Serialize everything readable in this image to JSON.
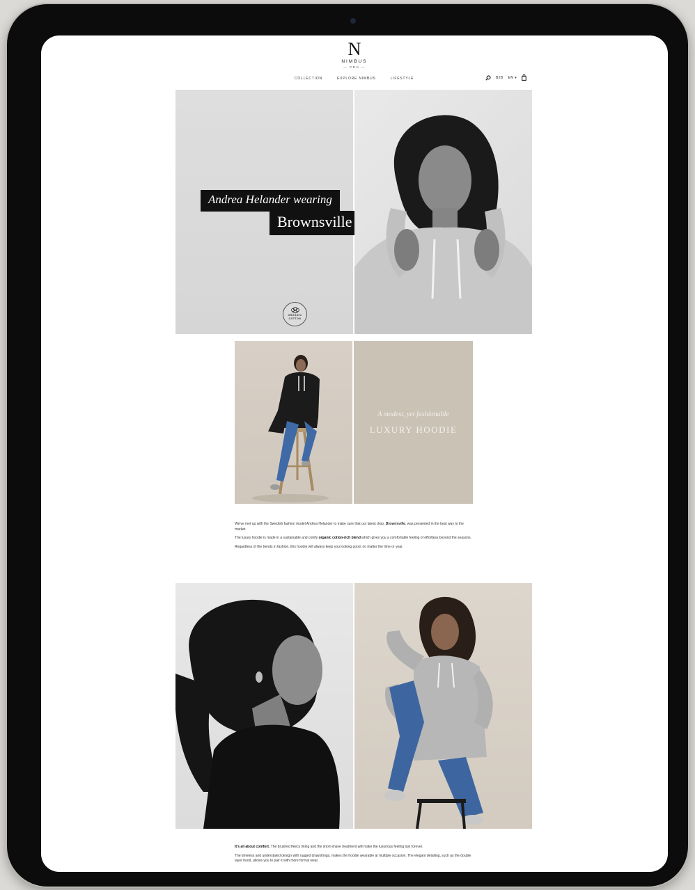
{
  "brand": {
    "mark": "N",
    "name": "NIMBUS",
    "tagline": "— CRH —"
  },
  "nav": {
    "items": [
      "COLLECTION",
      "EXPLORE NIMBUS",
      "LIFESTYLE"
    ]
  },
  "header_utils": {
    "search_icon": "search-icon",
    "b2b_label": "B2B",
    "language_label": "EN",
    "cart_icon": "bag-icon"
  },
  "hero": {
    "caption_line1": "Andrea Helander wearing",
    "caption_line2": "Brownsville",
    "badge_line1": "ORGANIC",
    "badge_line2": "COTTON"
  },
  "feature": {
    "tagline_small": "A modest, yet fashionable",
    "tagline_big": "LUXURY HOODIE"
  },
  "copy": {
    "p1_start": "We've met up with the Swedish fashion model Andrea Helander to make sure that our latest drop, ",
    "p1_em": "Brownsville",
    "p1_end": ", was presented in the best way to the market.",
    "p2_start": "The luxury hoodie is made in a sustainable and comfy ",
    "p2_strong": "organic cotton-rich blend",
    "p2_end": " which gives you a comfortable feeling of effortless beyond the seasons.",
    "p3": "Regardless of the trends in fashion, this hoodie will always keep you looking good, no matter the time or year."
  },
  "copy2": {
    "p1_strong": "It's all about comfort.",
    "p1_rest": " The brushed fleecy lining and the short-shave treatment will make the luxurious feeling last forever.",
    "p2": "The timeless and understated design with rugged drawstrings, makes the hoodie wearable at multiple occasion. The elegant detailing, such as the double layer hood, allows you to pair it with more formal wear."
  }
}
